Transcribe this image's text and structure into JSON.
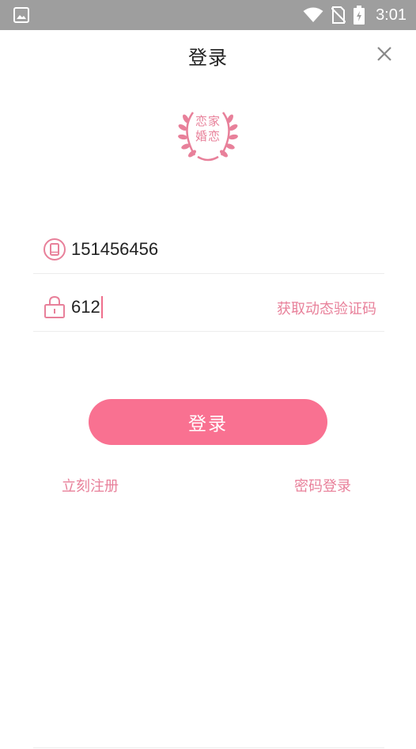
{
  "status_bar": {
    "time": "3:01",
    "icons": [
      "gallery-icon",
      "wifi-icon",
      "no-sim-icon",
      "battery-icon"
    ]
  },
  "header": {
    "title": "登录",
    "close_icon": "close-icon"
  },
  "logo": {
    "text": "恋家婚恋"
  },
  "form": {
    "phone": {
      "icon": "phone-icon",
      "value": "151456456"
    },
    "code": {
      "icon": "lock-icon",
      "value": "612",
      "get_code_label": "获取动态验证码"
    }
  },
  "login_button": {
    "label": "登录"
  },
  "links": {
    "register": "立刻注册",
    "password_login": "密码登录"
  },
  "colors": {
    "accent": "#f97191",
    "accent_text": "#e8809a",
    "status_bar": "#9e9e9e"
  }
}
